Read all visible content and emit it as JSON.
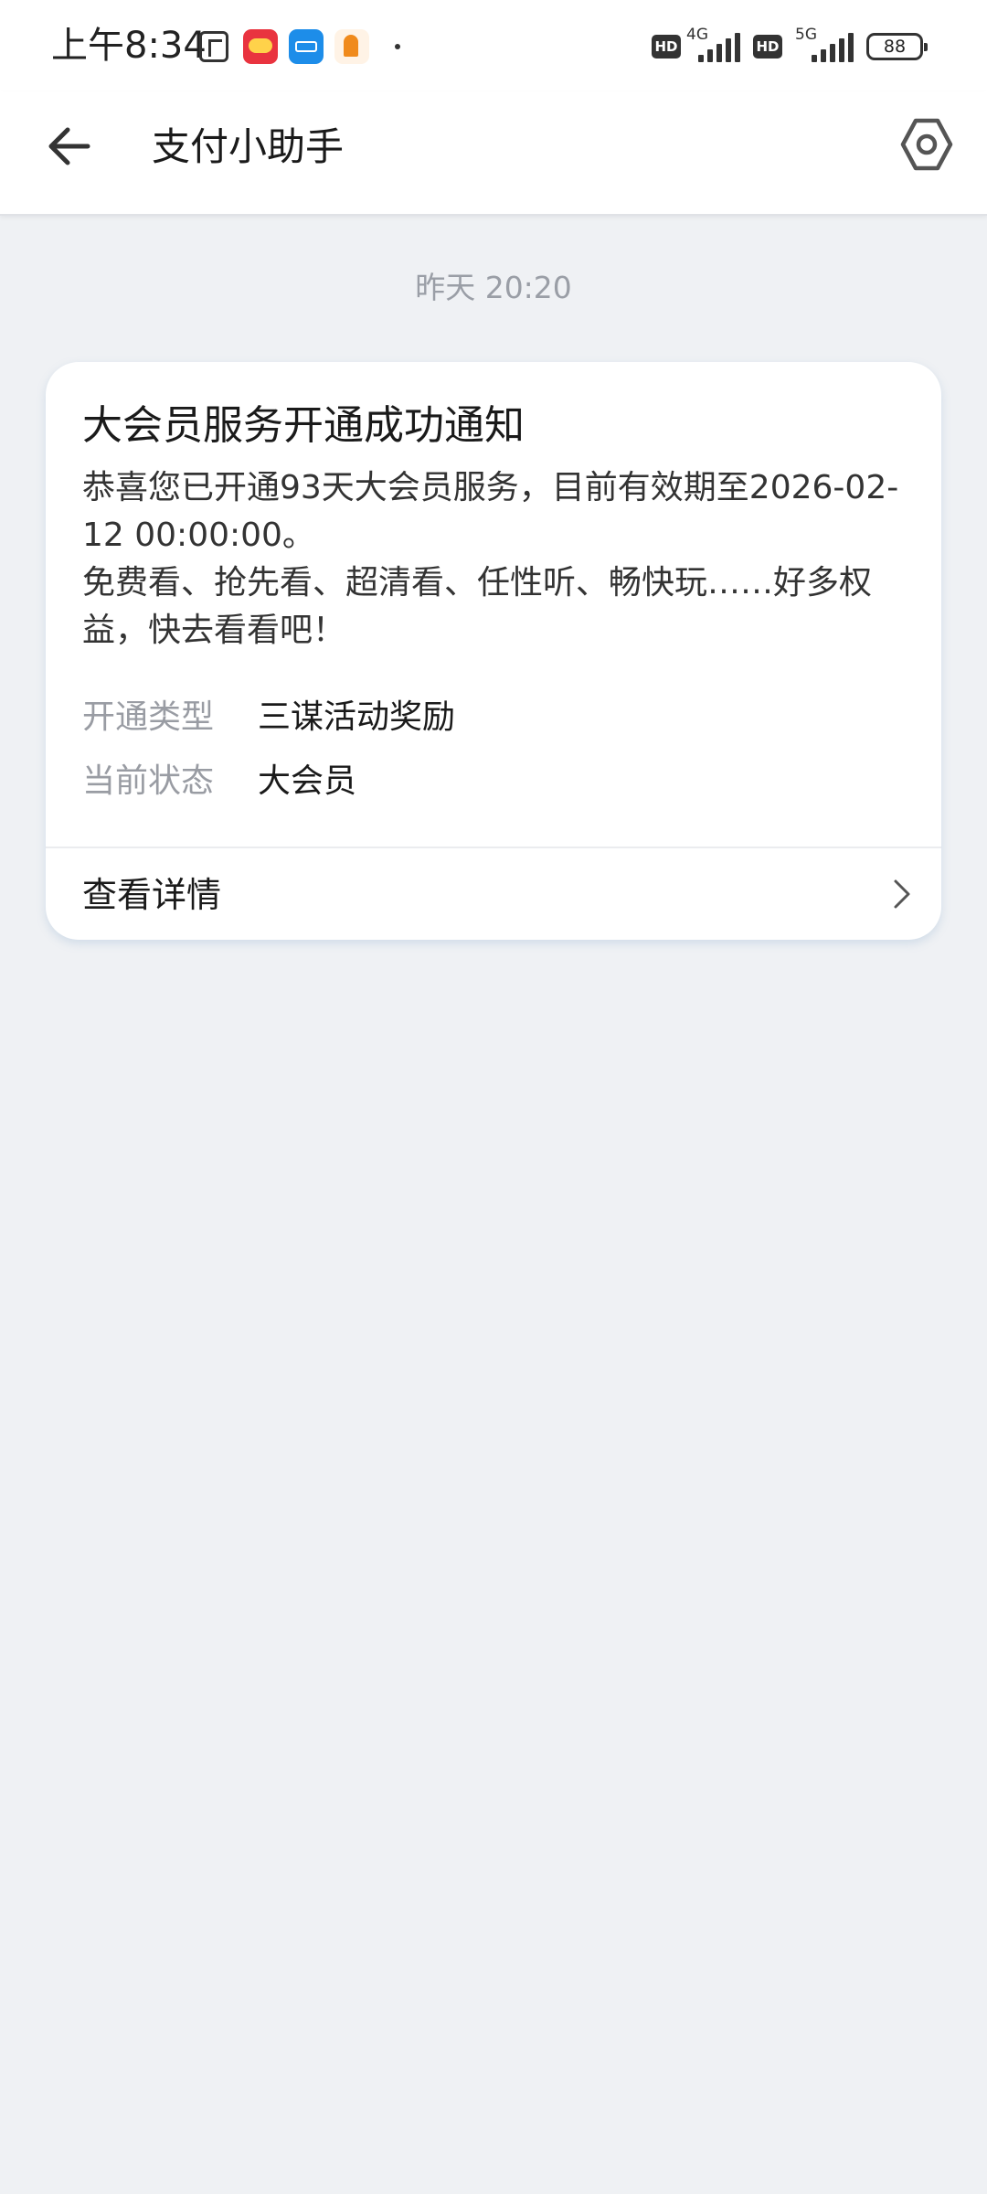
{
  "status_bar": {
    "time": "上午8:34",
    "network_1": "4G",
    "network_2": "5G",
    "hd_label": "HD",
    "battery": "88"
  },
  "nav": {
    "title": "支付小助手"
  },
  "chat": {
    "timestamp": "昨天 20:20",
    "card": {
      "title": "大会员服务开通成功通知",
      "body_line_1": "恭喜您已开通93天大会员服务，目前有效期至2026-02-12 00:00:00。",
      "body_line_2": "免费看、抢先看、超清看、任性听、畅快玩……好多权益，快去看看吧！",
      "rows": [
        {
          "label": "开通类型",
          "value": "三谋活动奖励"
        },
        {
          "label": "当前状态",
          "value": "大会员"
        }
      ],
      "link_label": "查看详情"
    }
  }
}
